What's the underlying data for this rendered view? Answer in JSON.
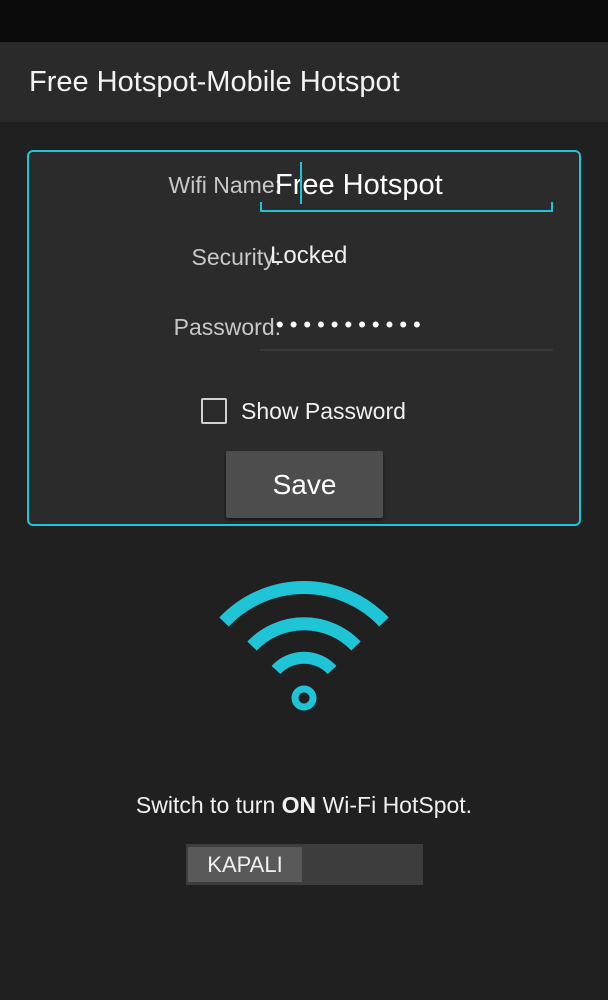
{
  "app_bar": {
    "title": "Free Hotspot-Mobile Hotspot"
  },
  "form": {
    "wifi_name_label": "Wifi Name:",
    "wifi_name_value": "Free Hotspot",
    "security_label": "Security:",
    "security_value": "Locked",
    "password_label": "Password:",
    "password_masked": "•••••••••••",
    "show_password_label": "Show Password",
    "show_password_checked": false,
    "save_label": "Save"
  },
  "hotspot": {
    "instruction_prefix": "Switch to turn ",
    "instruction_emphasis": "ON",
    "instruction_suffix": " Wi-Fi HotSpot.",
    "toggle_label": "KAPALI",
    "toggle_state": "off"
  },
  "colors": {
    "accent": "#1fc4d6",
    "background": "#202020",
    "app_bar": "#2a2a2a",
    "button": "#4d4d4d"
  },
  "icons": {
    "hotspot": "wifi-icon"
  }
}
